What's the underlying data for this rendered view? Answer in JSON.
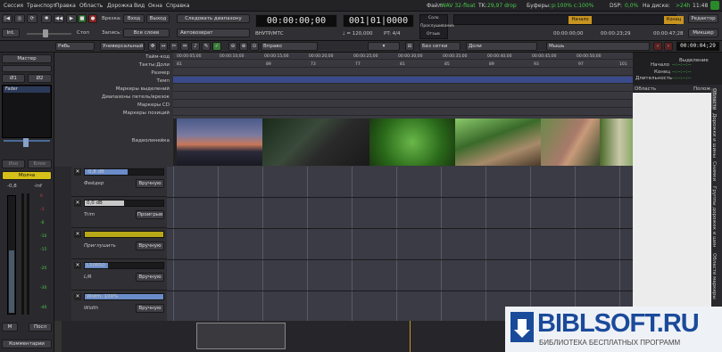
{
  "menu": [
    "Сессия",
    "Транспорт",
    "Правка",
    "Область",
    "Дорожка",
    "Вид",
    "Окна",
    "Справка"
  ],
  "status": {
    "file_label": "Файл:",
    "file_value": "WAV 32-float",
    "tc_label": "TK:",
    "tc_value": "29,97 drop",
    "buffers_label": "Буферы:",
    "buffers_value": "p:100% c:100%",
    "dsp_label": "DSP:",
    "dsp_value": "0,0%",
    "disk_label": "На диске:",
    "disk_value": ">24h",
    "time": "11:48"
  },
  "transport": {
    "int": "Int.",
    "stop": "Стоп",
    "insert": "Врезка:",
    "in": "Вход",
    "out": "Выход",
    "follow": "Следовать диапазону",
    "rec": "Запись:",
    "all_layers": "Все слоев",
    "autoreturn": "Автовозврат",
    "clock1": "00:00:00;00",
    "clock1_sub": "ВНУТР/МТС",
    "clock2": "001|01|0000",
    "clock2_bpm": "♩ = 120,000",
    "clock2_ts": "PT: 4/4",
    "solo": "Соло",
    "listen": "Прослушивание",
    "mute": "Отзыв",
    "start": "Начало",
    "end": "Конец",
    "time_a": "00:00:00;00",
    "time_b": "00:00:23;29",
    "time_c": "00:00:47;28",
    "editor": "Редактор",
    "mixer": "Микшер"
  },
  "toolbar2": {
    "ripple": "Рябь",
    "universal": "Универсальный",
    "right": "Вправо",
    "no_grid": "Без сетки",
    "grid": "Доли",
    "mouse": "Мышь",
    "clock": "00:00:04;29"
  },
  "left": {
    "master": "Мастер",
    "ch1": "Ø1",
    "ch2": "Ø2",
    "fader": "Fader",
    "iso": "Изо",
    "block": "Блок",
    "mute": "Молча",
    "val1": "-0,8",
    "val2": "-inf",
    "m": "M",
    "post": "Посл",
    "comments": "Комментарии",
    "meter_marks": [
      "0",
      "-3",
      "-6",
      "-10",
      "-15",
      "-20",
      "-30",
      "-40"
    ]
  },
  "rulers": [
    "Тайм-код",
    "Такты:Доли",
    "Размер",
    "Темп",
    "Маркеры выделений",
    "Диапазоны петель/врезок",
    "Маркеры CD",
    "Маркеры позиций",
    "Видеолинейка"
  ],
  "timecode_ticks": [
    "00:00:05;00",
    "00:00:10;00",
    "00:00:15;00",
    "00:00:20;00",
    "00:00:25;00",
    "00:00:30;00",
    "00:00:35;00",
    "00:00:40;00",
    "00:00:45;00",
    "00:00:50;00"
  ],
  "bar_ticks": [
    "81",
    "89",
    "73",
    "77",
    "81",
    "85",
    "89",
    "93",
    "97",
    "101"
  ],
  "tracks": [
    {
      "value": "-0,8 dB",
      "name": "Фейдер",
      "mode": "Вручную",
      "bar": "#6a8cc8",
      "fill": 0.55
    },
    {
      "value": "0,0 dB",
      "name": "Trim",
      "mode": "Проигрыв",
      "bar": "#c8c8c8",
      "fill": 0.5
    },
    {
      "value": "",
      "name": "Приглушить",
      "mode": "Вручную",
      "bar": "#b8a818",
      "fill": 1.0
    },
    {
      "value": "L50R50",
      "name": "L/R",
      "mode": "Вручную",
      "bar": "#6a8cc8",
      "fill": 0.3
    },
    {
      "value": "Width: 100%",
      "name": "Width",
      "mode": "Вручную",
      "bar": "#6a8cc8",
      "fill": 1.0
    }
  ],
  "right": {
    "selection": "Выделение",
    "start": "Начало",
    "end": "Конец",
    "length": "Длительность",
    "dashes": "--:--:--:--",
    "region": "Область",
    "full": "Полож",
    "tabs": [
      "Области",
      "Дорожки и шины",
      "Снимки",
      "Группы дорожек и шин",
      "Области маркеры"
    ]
  },
  "watermark": {
    "title": "BIBLSOFT.RU",
    "subtitle": "БИБЛИОТЕКА БЕСПЛАТНЫХ ПРОГРАММ"
  },
  "colors": {
    "accent": "#49c84a",
    "mute_yellow": "#d4c018",
    "blue": "#6a8cc8"
  }
}
